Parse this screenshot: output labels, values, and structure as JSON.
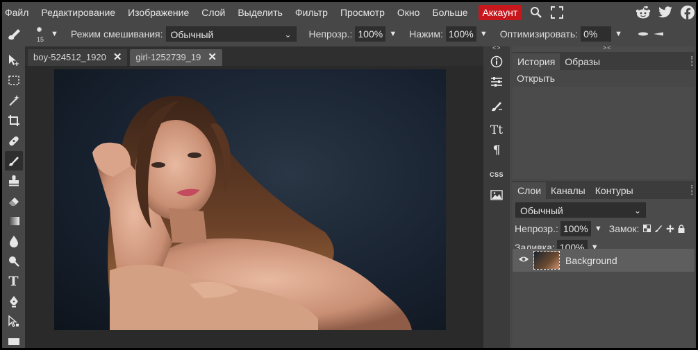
{
  "menu": {
    "items": [
      "Файл",
      "Редактирование",
      "Изображение",
      "Слой",
      "Выделить",
      "Фильтр",
      "Просмотр",
      "Окно",
      "Больше"
    ],
    "account": "Аккаунт",
    "search_icon": "search-icon",
    "fullscreen_icon": "fullscreen-icon",
    "social": [
      "reddit-icon",
      "twitter-icon",
      "facebook-icon"
    ]
  },
  "options": {
    "brush_size": "15",
    "blend_label": "Режим смешивания:",
    "blend_value": "Обычный",
    "opacity_label": "Непрозр.:",
    "opacity_value": "100%",
    "pressure_label": "Нажим:",
    "pressure_value": "100%",
    "optimize_label": "Оптимизировать:",
    "optimize_value": "0%"
  },
  "tabs": [
    {
      "label": "boy-524512_1920",
      "close": "✕"
    },
    {
      "label": "girl-1252739_19",
      "close": "✕"
    }
  ],
  "right_tools": {
    "type_glyph": "Tt",
    "paragraph_glyph": "¶",
    "css_label": "CSS",
    "collapse_top": "<>",
    "collapse_panel": "><"
  },
  "history_panel": {
    "tabs": [
      "История",
      "Образы"
    ],
    "items": [
      "Открыть"
    ]
  },
  "layers_panel": {
    "tabs": [
      "Слои",
      "Каналы",
      "Контуры"
    ],
    "blend_value": "Обычный",
    "opacity_label": "Непрозр.:",
    "opacity_value": "100%",
    "lock_label": "Замок:",
    "fill_label": "Заливка:",
    "fill_value": "100%",
    "layers": [
      {
        "name": "Background"
      }
    ]
  },
  "colors": {
    "account_bg": "#c8161d",
    "ui_bg": "#474747",
    "workspace_bg": "#2a2a2a",
    "selected_layer": "#5e5e5e"
  }
}
